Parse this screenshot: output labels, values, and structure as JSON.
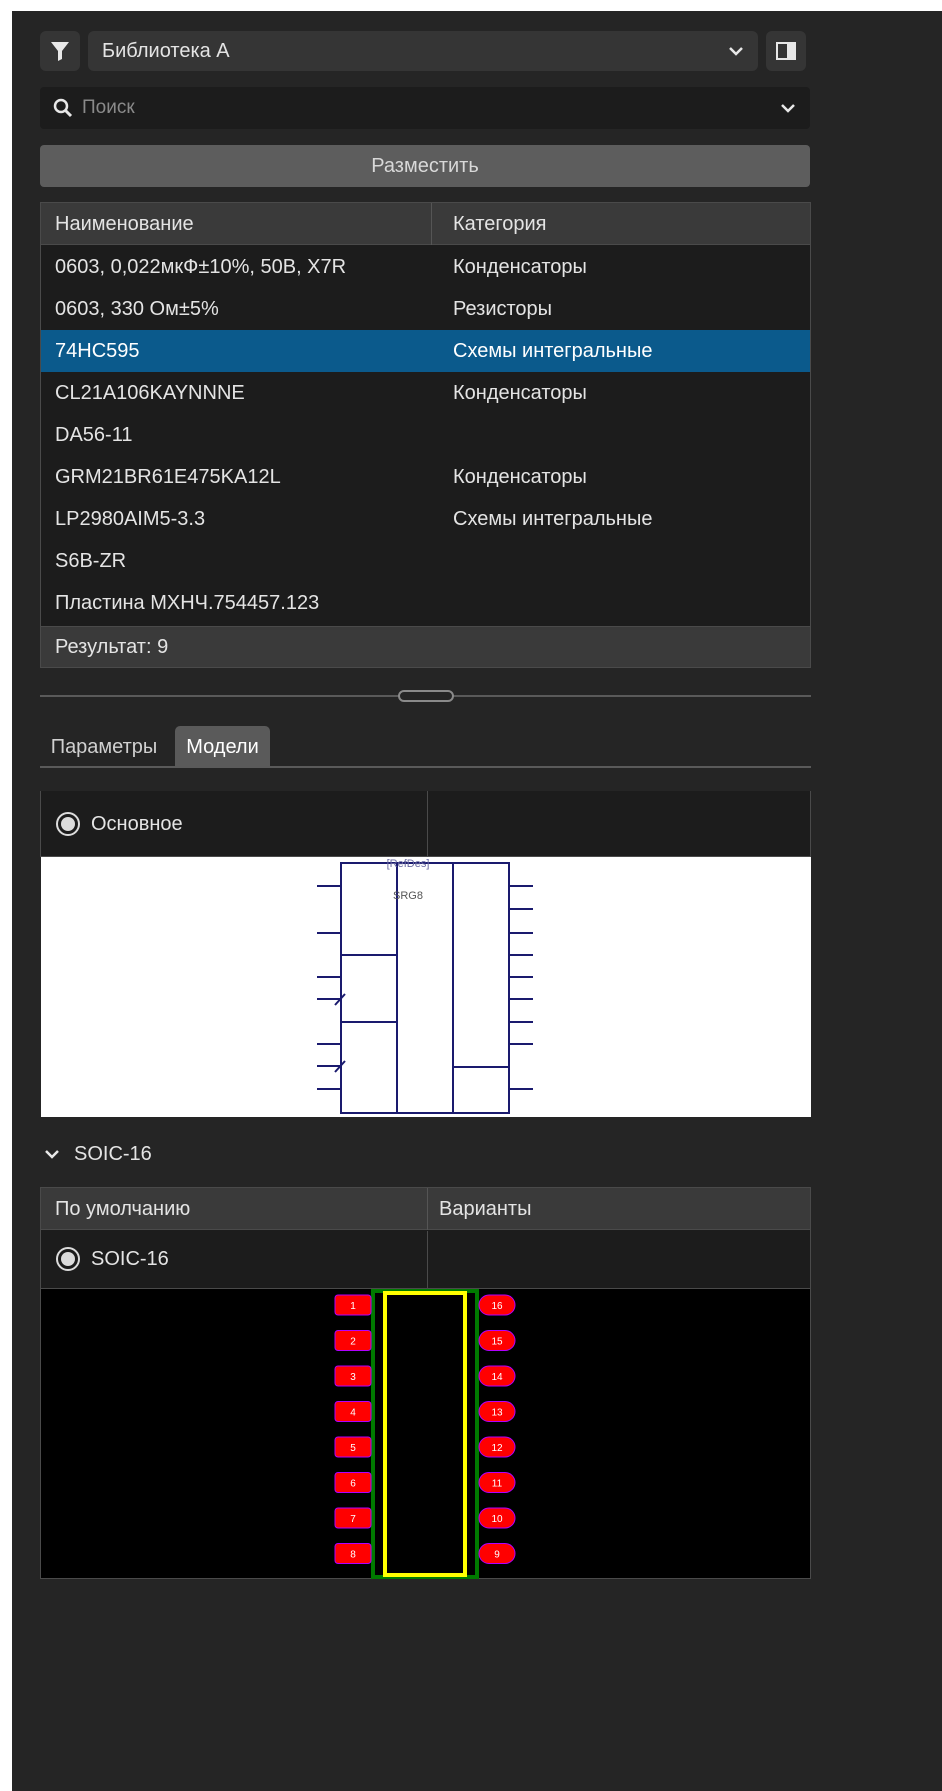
{
  "toolbar": {
    "library_select_value": "Библиотека А",
    "search_placeholder": "Поиск",
    "place_button_label": "Разместить"
  },
  "table": {
    "columns": [
      "Наименование",
      "Категория"
    ],
    "rows": [
      {
        "name": "0603, 0,022мкФ±10%, 50В, X7R",
        "category": "Конденсаторы"
      },
      {
        "name": "0603, 330 Ом±5%",
        "category": "Резисторы"
      },
      {
        "name": "74HC595",
        "category": "Схемы интегральные"
      },
      {
        "name": "CL21A106KAYNNNE",
        "category": "Конденсаторы"
      },
      {
        "name": "DA56-11",
        "category": ""
      },
      {
        "name": "GRM21BR61E475KA12L",
        "category": "Конденсаторы"
      },
      {
        "name": "LP2980AIM5-3.3",
        "category": "Схемы интегральные"
      },
      {
        "name": "S6B-ZR",
        "category": ""
      },
      {
        "name": "Пластина МХНЧ.754457.123",
        "category": ""
      }
    ],
    "selected_index": 2,
    "result_label": "Результат: 9"
  },
  "tabs": [
    {
      "label": "Параметры",
      "active": false
    },
    {
      "label": "Модели",
      "active": true
    }
  ],
  "schematic": {
    "option_label": "Основное",
    "refdes_label": "[RefDes]",
    "type_label": "SRG8"
  },
  "footprint": {
    "section_title": "SOIC-16",
    "columns": [
      "По умолчанию",
      "Варианты"
    ],
    "option_label": "SOIC-16",
    "pins_left": [
      "1",
      "2",
      "3",
      "4",
      "5",
      "6",
      "7",
      "8"
    ],
    "pins_right": [
      "16",
      "15",
      "14",
      "13",
      "12",
      "11",
      "10",
      "9"
    ]
  },
  "colors": {
    "panel_bg": "#252525",
    "selection": "#0b5a8c",
    "pad": "#ff0000",
    "silkscreen": "#ffff00",
    "courtyard": "#007a00",
    "schematic_line": "#1a1a6e"
  }
}
